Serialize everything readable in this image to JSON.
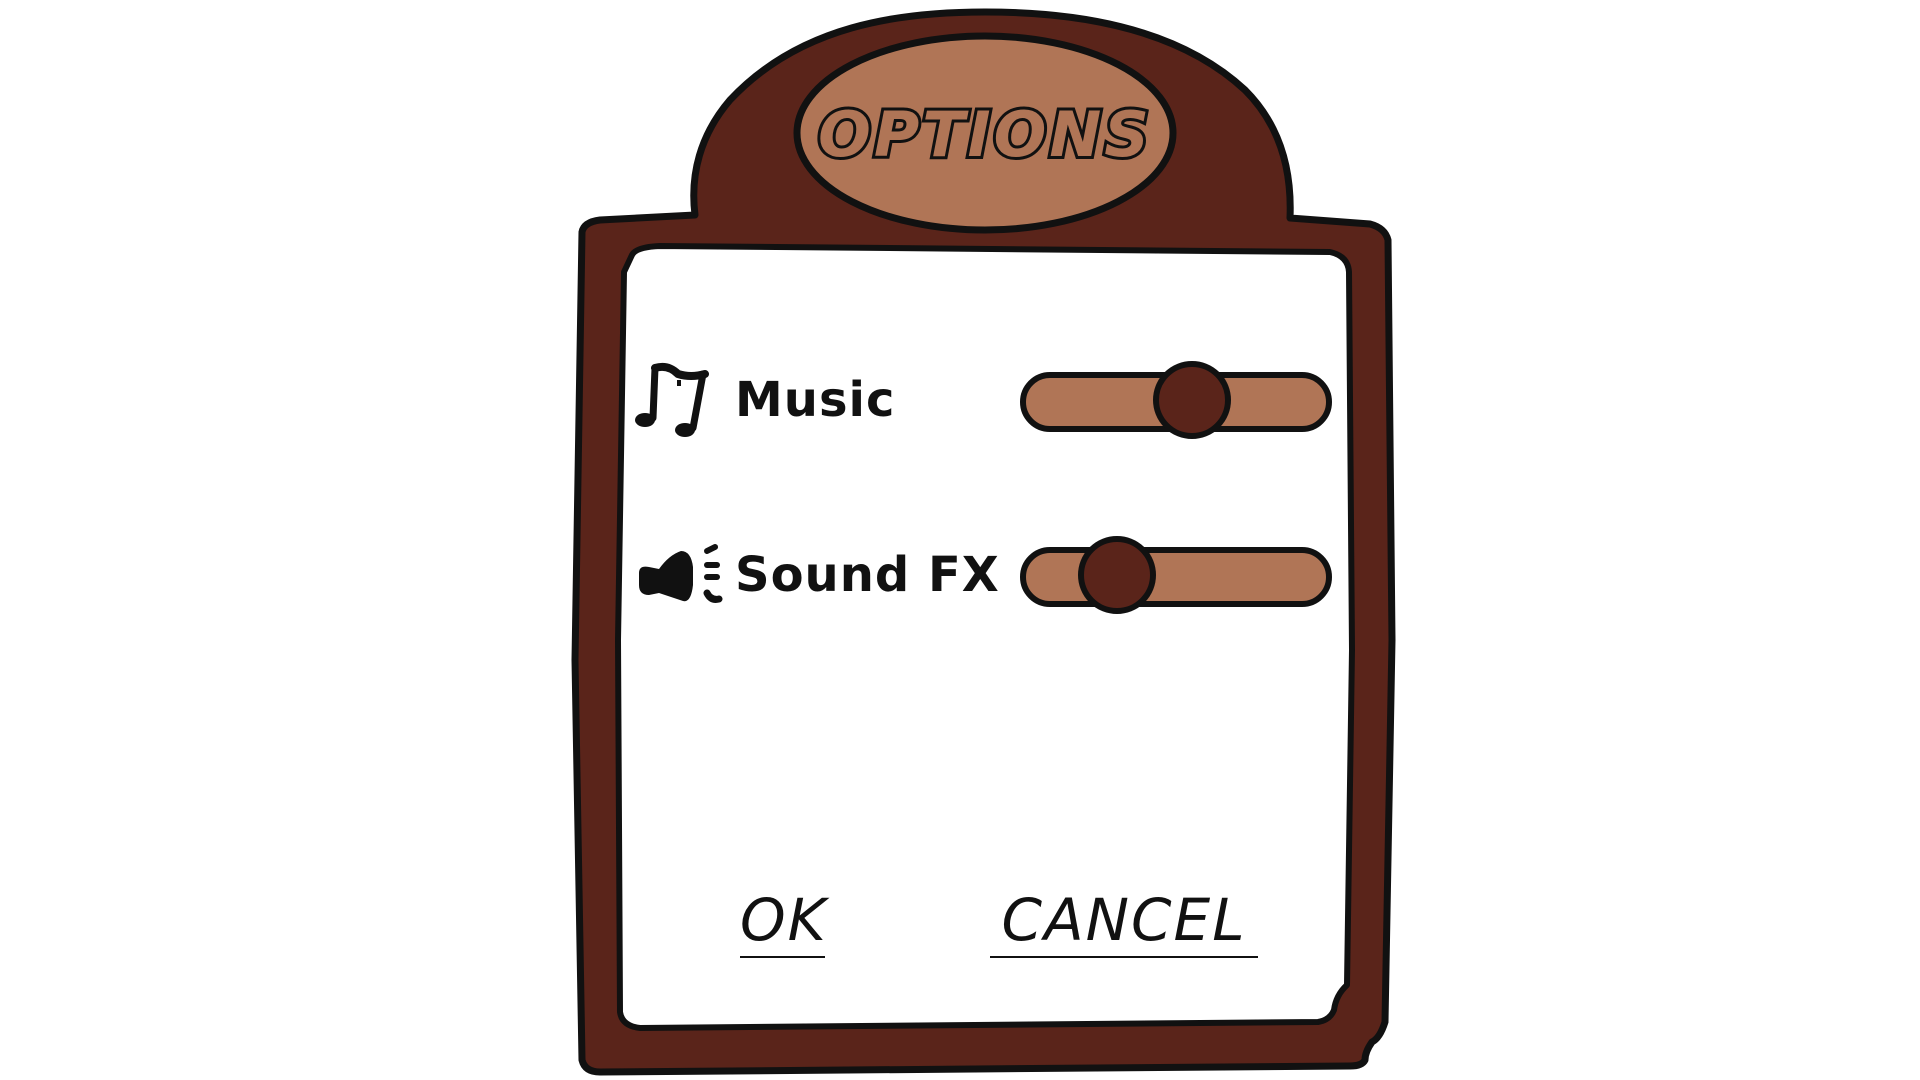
{
  "dialog": {
    "title": "OPTIONS",
    "ok_label": "OK",
    "cancel_label": "CANCEL"
  },
  "settings": [
    {
      "label": "Music",
      "icon": "music-note-icon",
      "level": 0.55
    },
    {
      "label": "Sound FX",
      "icon": "speaker-icon",
      "level": 0.31
    }
  ],
  "colors": {
    "frame": "#5a241a",
    "accent": "#b07556",
    "panel": "#ffffff",
    "outline": "#111111"
  }
}
